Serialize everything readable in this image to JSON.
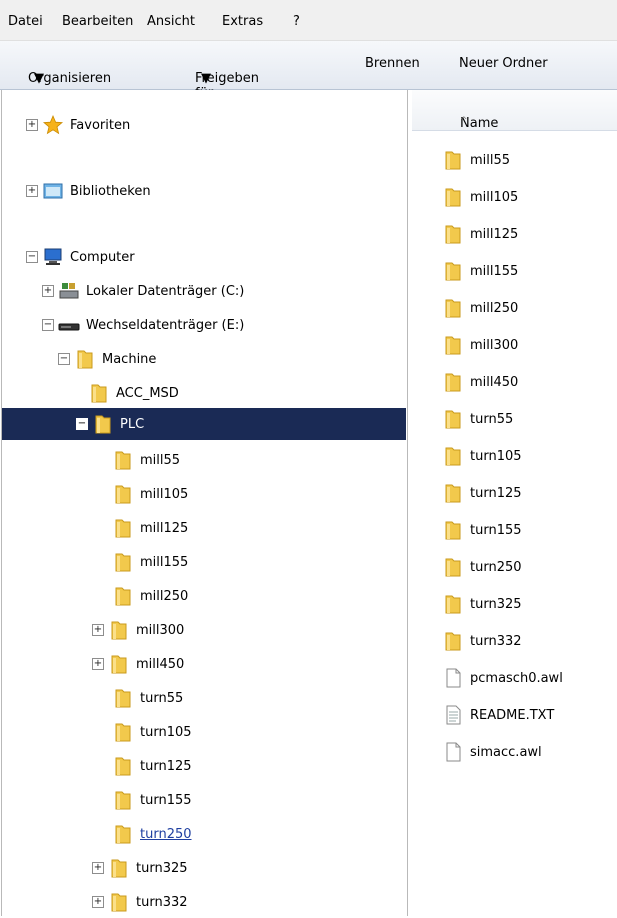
{
  "menubar": [
    "Datei",
    "Bearbeiten",
    "Ansicht",
    "Extras",
    "?"
  ],
  "toolbar": {
    "organisieren": "Organisieren",
    "freigeben": "Freigeben für",
    "brennen": "Brennen",
    "neuer_ordner": "Neuer Ordner"
  },
  "column": {
    "name": "Name",
    "sort_glyph": "^"
  },
  "nav": {
    "favoriten": "Favoriten",
    "bibliotheken": "Bibliotheken",
    "computer": "Computer",
    "lokaler": "Lokaler Datenträger (C:)",
    "wechsel": "Wechseldatenträger (E:)",
    "machine": "Machine",
    "acc_msd": "ACC_MSD",
    "plc": "PLC",
    "plc_children": [
      "mill55",
      "mill105",
      "mill125",
      "mill155",
      "mill250",
      "mill300",
      "mill450",
      "turn55",
      "turn105",
      "turn125",
      "turn155",
      "turn250",
      "turn325",
      "turn332"
    ],
    "hover_item": "turn250"
  },
  "files": {
    "folders": [
      "mill55",
      "mill105",
      "mill125",
      "mill155",
      "mill250",
      "mill300",
      "mill450",
      "turn55",
      "turn105",
      "turn125",
      "turn155",
      "turn250",
      "turn325",
      "turn332"
    ],
    "documents": [
      "pcmasch0.awl",
      "README.TXT",
      "simacc.awl"
    ]
  },
  "colors": {
    "selection": "#1a2a55",
    "link": "#1f3fa0",
    "folder": "#f2c94c"
  }
}
